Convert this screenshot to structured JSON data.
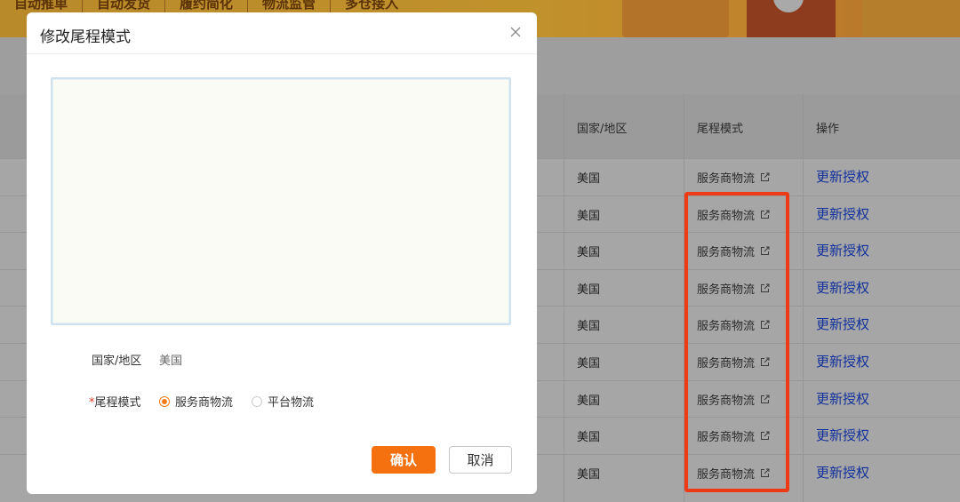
{
  "top_nav": {
    "items": [
      "自动推单",
      "自动发货",
      "履约简化",
      "物流监管",
      "多仓接入"
    ]
  },
  "table": {
    "headers": {
      "country": "国家/地区",
      "mode": "尾程模式",
      "action": "操作"
    },
    "rows": [
      {
        "country": "美国",
        "mode": "服务商物流",
        "action": "更新授权"
      },
      {
        "country": "美国",
        "mode": "服务商物流",
        "action": "更新授权"
      },
      {
        "country": "美国",
        "mode": "服务商物流",
        "action": "更新授权"
      },
      {
        "country": "美国",
        "mode": "服务商物流",
        "action": "更新授权"
      },
      {
        "country": "美国",
        "mode": "服务商物流",
        "action": "更新授权"
      },
      {
        "country": "美国",
        "mode": "服务商物流",
        "action": "更新授权"
      },
      {
        "country": "美国",
        "mode": "服务商物流",
        "action": "更新授权"
      },
      {
        "country": "美国",
        "mode": "服务商物流",
        "action": "更新授权"
      },
      {
        "country": "美国",
        "mode": "服务商物流",
        "action": "更新授权"
      }
    ],
    "highlight_color": "#ee3b16"
  },
  "modal": {
    "title": "修改尾程模式",
    "close_icon": "close-icon",
    "textarea_value": "",
    "country_label": "国家/地区",
    "country_value": "美国",
    "mode_required_mark": "*",
    "mode_label": "尾程模式",
    "options": [
      {
        "label": "服务商物流",
        "checked": true
      },
      {
        "label": "平台物流",
        "checked": false
      }
    ],
    "confirm_label": "确认",
    "cancel_label": "取消",
    "accent_color": "#f5710f"
  }
}
